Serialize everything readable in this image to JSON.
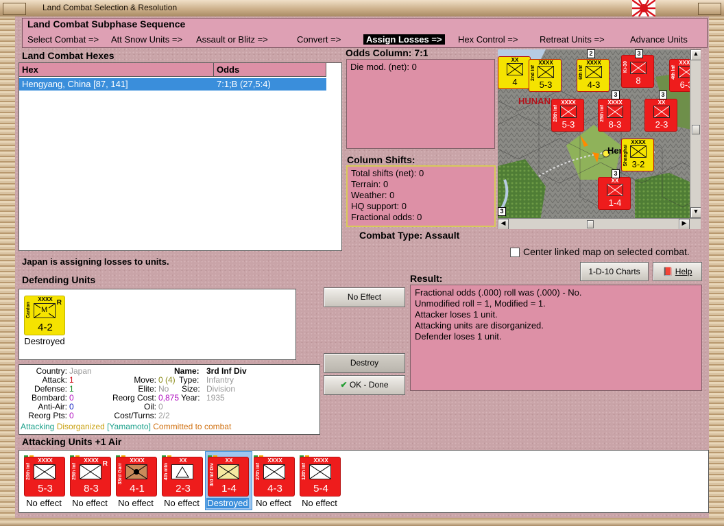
{
  "window": {
    "title": "Land Combat Selection & Resolution"
  },
  "sequence": {
    "title": "Land Combat Subphase Sequence",
    "steps": [
      "Select Combat =>",
      "Att Snow Units =>",
      "Assault or Blitz =>",
      "Convert =>",
      "Assign Losses =>",
      "Hex Control =>",
      "Retreat Units =>",
      "Advance Units"
    ],
    "active_index": 4
  },
  "hexes": {
    "title": "Land Combat Hexes",
    "columns": [
      "Hex",
      "Odds"
    ],
    "rows": [
      {
        "hex": "Hengyang, China [87, 141]",
        "odds": "7:1;B (27,5:4)"
      }
    ]
  },
  "odds": {
    "title": "Odds Column: 7:1",
    "die_mod": "Die mod. (net): 0"
  },
  "shifts": {
    "title": "Column Shifts:",
    "lines": [
      "Total shifts (net): 0",
      "Terrain: 0",
      "Weather: 0",
      "HQ support: 0",
      "Fractional odds: 0"
    ]
  },
  "combat_type": "Combat Type:  Assault",
  "map": {
    "region_label": "HUNAN",
    "city_label": "Hengyang",
    "chk_label": "Center linked map on selected combat.",
    "stack_numbers": [
      "3",
      "2",
      "3",
      "3",
      "3",
      "3"
    ],
    "counters": [
      {
        "val": "4",
        "size": "XX",
        "side": ""
      },
      {
        "val": "5-3",
        "size": "XXXX",
        "side": "2nd Inf"
      },
      {
        "val": "4-3",
        "size": "XXXX",
        "side": "6th Inf"
      },
      {
        "val": "8",
        "size": "",
        "side": "Ki-30"
      },
      {
        "val": "6-3",
        "size": "XXXX",
        "side": "4th Inf"
      },
      {
        "val": "5-3",
        "size": "XXXX",
        "side": "20th Inf"
      },
      {
        "val": "8-3",
        "size": "XXXX",
        "side": "25th Inf"
      },
      {
        "val": "2-3",
        "size": "XX",
        "side": ""
      },
      {
        "val": "3-2",
        "size": "XXXX",
        "side": "Shanghai"
      },
      {
        "val": "1-4",
        "size": "XX",
        "side": ""
      }
    ]
  },
  "buttons": {
    "charts": "1-D-10 Charts",
    "help": "Help",
    "no_effect": "No Effect",
    "destroy": "Destroy",
    "ok_done": "OK - Done"
  },
  "status": "Japan is assigning losses to units.",
  "defending": {
    "title": "Defending Units",
    "units": [
      {
        "size": "XXXX",
        "side": "Canton",
        "val": "4-2",
        "tag": "R",
        "letter": "M",
        "caption": "Destroyed",
        "color": "#f5e300"
      }
    ]
  },
  "result": {
    "title": "Result:",
    "lines": [
      "Fractional odds (.000) roll was (.000)  - No.",
      "Unmodified roll = 1, Modified = 1.",
      "Attacker loses 1 unit.",
      "Attacking units are disorganized.",
      "Defender loses 1 unit."
    ]
  },
  "details": {
    "country_label": "Country:",
    "country": "Japan",
    "attack_label": "Attack:",
    "attack": "1",
    "defense_label": "Defense:",
    "defense": "1",
    "bombard_label": "Bombard:",
    "bombard": "0",
    "antiair_label": "Anti-Air:",
    "antiair": "0",
    "reorg_label": "Reorg Pts:",
    "reorg": "0",
    "move_label": "Move:",
    "move": "0 (4)",
    "elite_label": "Elite:",
    "elite": "No",
    "reorgcost_label": "Reorg Cost:",
    "reorgcost": "0,875",
    "oil_label": "Oil:",
    "oil": "0",
    "costturns_label": "Cost/Turns:",
    "costturns": "2/2",
    "name_label": "Name:",
    "name": "3rd Inf Div",
    "type_label": "Type:",
    "type": "Infantry",
    "size_label": "Size:",
    "size": "Division",
    "year_label": "Year:",
    "year": "1935",
    "tag_attacking": "Attacking",
    "tag_disorganized": "Disorganized",
    "tag_leader": "[Yamamoto]",
    "tag_committed": "Committed to combat"
  },
  "attacking": {
    "title": "Attacking Units +1 Air",
    "units": [
      {
        "size": "XXXX",
        "side": "20th Inf",
        "val": "5-3",
        "tag": "",
        "caption": "No effect",
        "selected": false,
        "symbol": "inf"
      },
      {
        "size": "XXXX",
        "side": "25th Inf",
        "val": "8-3",
        "tag": "R",
        "caption": "No effect",
        "selected": false,
        "symbol": "inf"
      },
      {
        "size": "XXXX",
        "side": "33rd Garr",
        "val": "4-1",
        "tag": "",
        "caption": "No effect",
        "selected": false,
        "symbol": "garr"
      },
      {
        "size": "XX",
        "side": "4th mtn",
        "val": "2-3",
        "tag": "",
        "caption": "No effect",
        "selected": false,
        "symbol": "mtn"
      },
      {
        "size": "XX",
        "side": "3rd Inf Div",
        "val": "1-4",
        "tag": "",
        "caption": "Destroyed",
        "selected": true,
        "symbol": "inf"
      },
      {
        "size": "XXXX",
        "side": "27th Inf",
        "val": "4-3",
        "tag": "",
        "caption": "No effect",
        "selected": false,
        "symbol": "inf"
      },
      {
        "size": "XXXX",
        "side": "12th Inf",
        "val": "5-4",
        "tag": "",
        "caption": "No effect",
        "selected": false,
        "symbol": "inf"
      }
    ]
  },
  "colors": {
    "counter_red": "#ee1c1c",
    "counter_yellow": "#f5e300",
    "selection": "#3a8edb",
    "panel_pink": "#dd90a6"
  }
}
